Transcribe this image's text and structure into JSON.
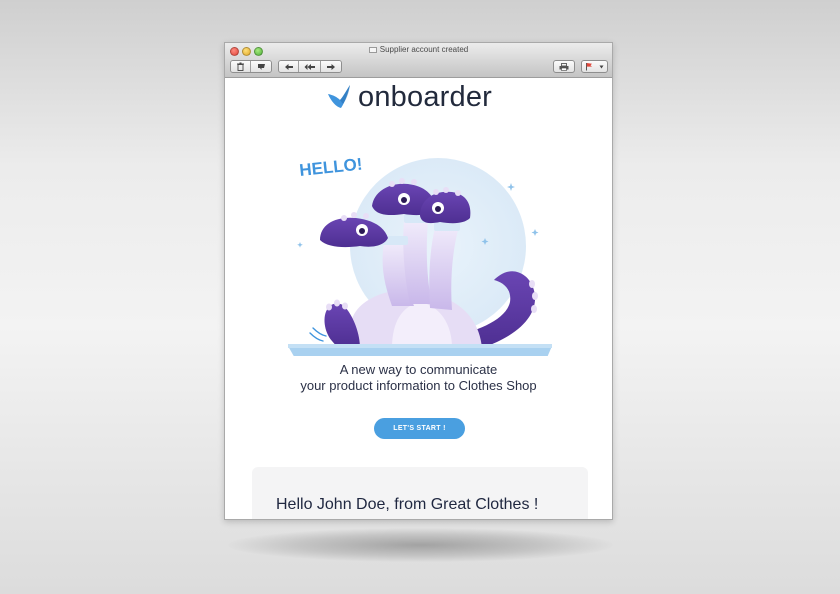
{
  "window": {
    "title": "Supplier account created"
  },
  "toolbar": {
    "buttons": [
      "trash-icon",
      "junk-icon",
      "reply-icon",
      "reply-all-icon",
      "forward-icon",
      "print-icon",
      "flag-icon"
    ]
  },
  "email": {
    "brand": "onboarder",
    "illustration_text": "HELLO!",
    "tagline_line1": "A new way to communicate",
    "tagline_line2": "your product information to Clothes Shop",
    "cta_label": "LET'S START !",
    "greeting": "Hello John Doe, from Great Clothes !"
  },
  "colors": {
    "brand_blue": "#4a9fe0",
    "dragon_purple": "#5b3aa1",
    "text_dark": "#2b3147"
  }
}
